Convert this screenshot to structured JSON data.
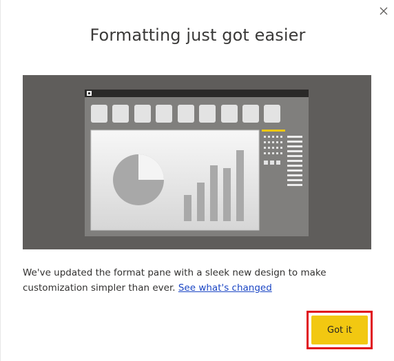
{
  "dialog": {
    "title": "Formatting just got easier",
    "description": "We've updated the format pane with a sleek new design to make customization simpler than ever.",
    "link_text": "See what's changed",
    "primary_button": "Got it",
    "close_icon": "close-icon",
    "illustration": "format-pane-illustration",
    "colors": {
      "primary_button": "#f2c811",
      "link": "#1a45c4",
      "highlight_border": "#e0101a"
    }
  }
}
